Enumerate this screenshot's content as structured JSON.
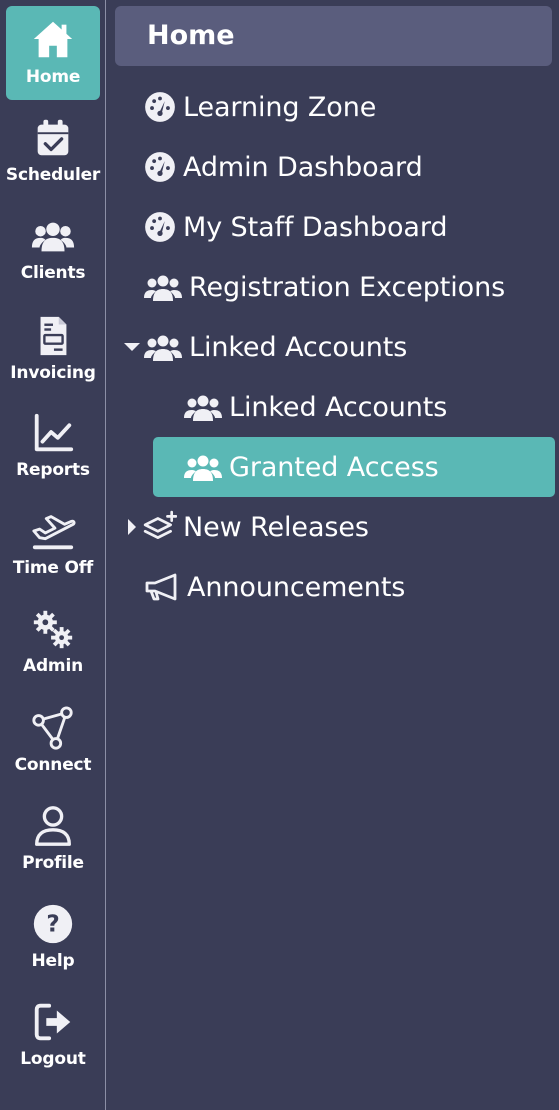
{
  "rail": {
    "items": [
      {
        "label": "Home",
        "icon": "home-icon"
      },
      {
        "label": "Scheduler",
        "icon": "calendar-check-icon"
      },
      {
        "label": "Clients",
        "icon": "users-icon"
      },
      {
        "label": "Invoicing",
        "icon": "invoice-icon"
      },
      {
        "label": "Reports",
        "icon": "line-chart-icon"
      },
      {
        "label": "Time Off",
        "icon": "plane-departure-icon"
      },
      {
        "label": "Admin",
        "icon": "gears-icon"
      },
      {
        "label": "Connect",
        "icon": "network-icon"
      },
      {
        "label": "Profile",
        "icon": "user-icon"
      },
      {
        "label": "Help",
        "icon": "question-circle-icon"
      },
      {
        "label": "Logout",
        "icon": "sign-out-icon"
      }
    ],
    "active": "Home"
  },
  "panel": {
    "title": "Home",
    "items": [
      {
        "label": "Learning Zone",
        "icon": "gauge-icon"
      },
      {
        "label": "Admin Dashboard",
        "icon": "gauge-icon"
      },
      {
        "label": "My Staff Dashboard",
        "icon": "gauge-icon"
      },
      {
        "label": "Registration Exceptions",
        "icon": "users-icon"
      },
      {
        "label": "Linked Accounts",
        "icon": "users-icon",
        "expanded": true
      },
      {
        "label": "Linked Accounts",
        "icon": "users-icon"
      },
      {
        "label": "Granted Access",
        "icon": "users-icon",
        "selected": true
      },
      {
        "label": "New Releases",
        "icon": "layers-plus-icon",
        "expanded": false
      },
      {
        "label": "Announcements",
        "icon": "megaphone-icon"
      }
    ]
  },
  "colors": {
    "background": "#3a3d57",
    "accent": "#5ab8b5",
    "header": "#5a5d7d",
    "divider": "#8c8fa6",
    "icon": "#f0f0f5"
  }
}
